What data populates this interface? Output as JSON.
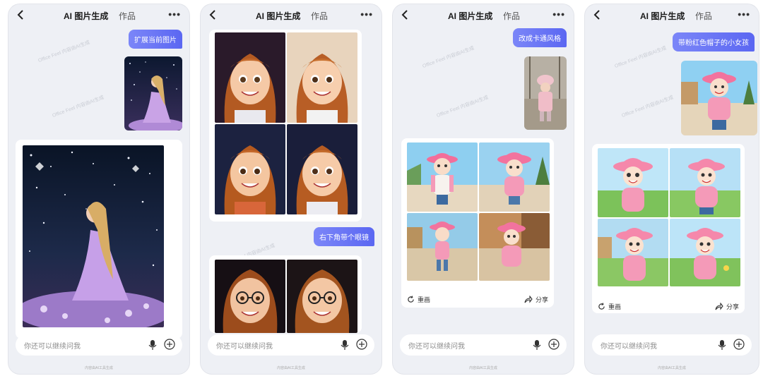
{
  "header": {
    "title": "AI 图片生成",
    "works_tab": "作品",
    "more": "•••"
  },
  "input": {
    "placeholder": "你还可以继续问我"
  },
  "footnote": "内容由AI工具生成",
  "watermark": "Office Feel 内容由AI生成",
  "panels": [
    {
      "prompt": "扩展当前图片",
      "actions": null
    },
    {
      "prompt": "右下角带个眼镜",
      "actions": null
    },
    {
      "prompt": "改成卡通风格",
      "actions": {
        "regenerate": "重画",
        "share": "分享"
      }
    },
    {
      "prompt": "带粉红色帽子的小女孩",
      "actions": {
        "regenerate": "重画",
        "share": "分享"
      }
    }
  ],
  "icons": {
    "back": "chevron-left-icon",
    "more": "more-icon",
    "mic": "mic-icon",
    "plus": "plus-icon",
    "regenerate": "refresh-icon",
    "share": "share-icon"
  },
  "colors": {
    "bubble": "#6d78f7",
    "background": "#eef0f5"
  }
}
